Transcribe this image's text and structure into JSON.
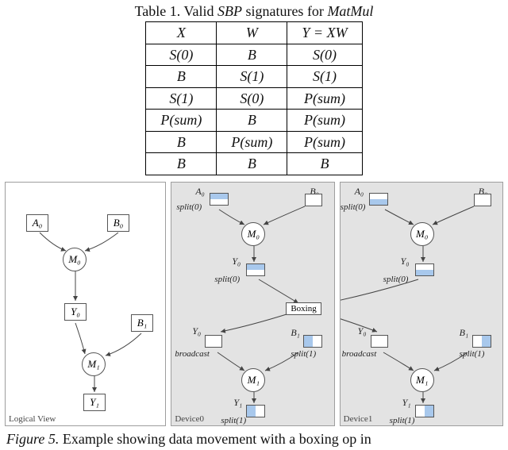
{
  "table": {
    "titleParts": {
      "lead": "Table 1.",
      "mid": " Valid ",
      "sbp": "SBP",
      "mid2": " signatures for ",
      "op": "MatMul"
    },
    "headers": {
      "c0": "X",
      "c1": "W",
      "c2": "Y = XW"
    },
    "rows": [
      {
        "c0": "S(0)",
        "c1": "B",
        "c2": "S(0)"
      },
      {
        "c0": "B",
        "c1": "S(1)",
        "c2": "S(1)"
      },
      {
        "c0": "S(1)",
        "c1": "S(0)",
        "c2": "P(sum)"
      },
      {
        "c0": "P(sum)",
        "c1": "B",
        "c2": "P(sum)"
      },
      {
        "c0": "B",
        "c1": "P(sum)",
        "c2": "P(sum)"
      },
      {
        "c0": "B",
        "c1": "B",
        "c2": "B"
      }
    ]
  },
  "panels": {
    "logical": {
      "label": "Logical View",
      "A0": "A₀",
      "B0": "B₀",
      "M0": "M₀",
      "Y0": "Y₀",
      "B1": "B₁",
      "M1": "M₁",
      "Y1": "Y₁"
    },
    "device0": {
      "label": "Device0",
      "A0": "A₀",
      "B0": "B₀",
      "M0": "M₀",
      "Y0": "Y₀",
      "Y0b": "Y₀",
      "B1": "B₁",
      "M1": "M₁",
      "Y1": "Y₁",
      "split0": "split(0)",
      "split1": "split(1)",
      "broadcast": "broadcast",
      "boxing": "Boxing"
    },
    "device1": {
      "label": "Device1",
      "A0": "A₀",
      "B0": "B₀",
      "M0": "M₀",
      "Y0": "Y₀",
      "Y0b": "Y₀",
      "B1": "B₁",
      "M1": "M₁",
      "Y1": "Y₁",
      "split0": "split(0)",
      "split1": "split(1)",
      "broadcast": "broadcast"
    }
  },
  "figure": {
    "lead": "Figure 5.",
    "rest": " Example showing data movement with a boxing op in"
  }
}
